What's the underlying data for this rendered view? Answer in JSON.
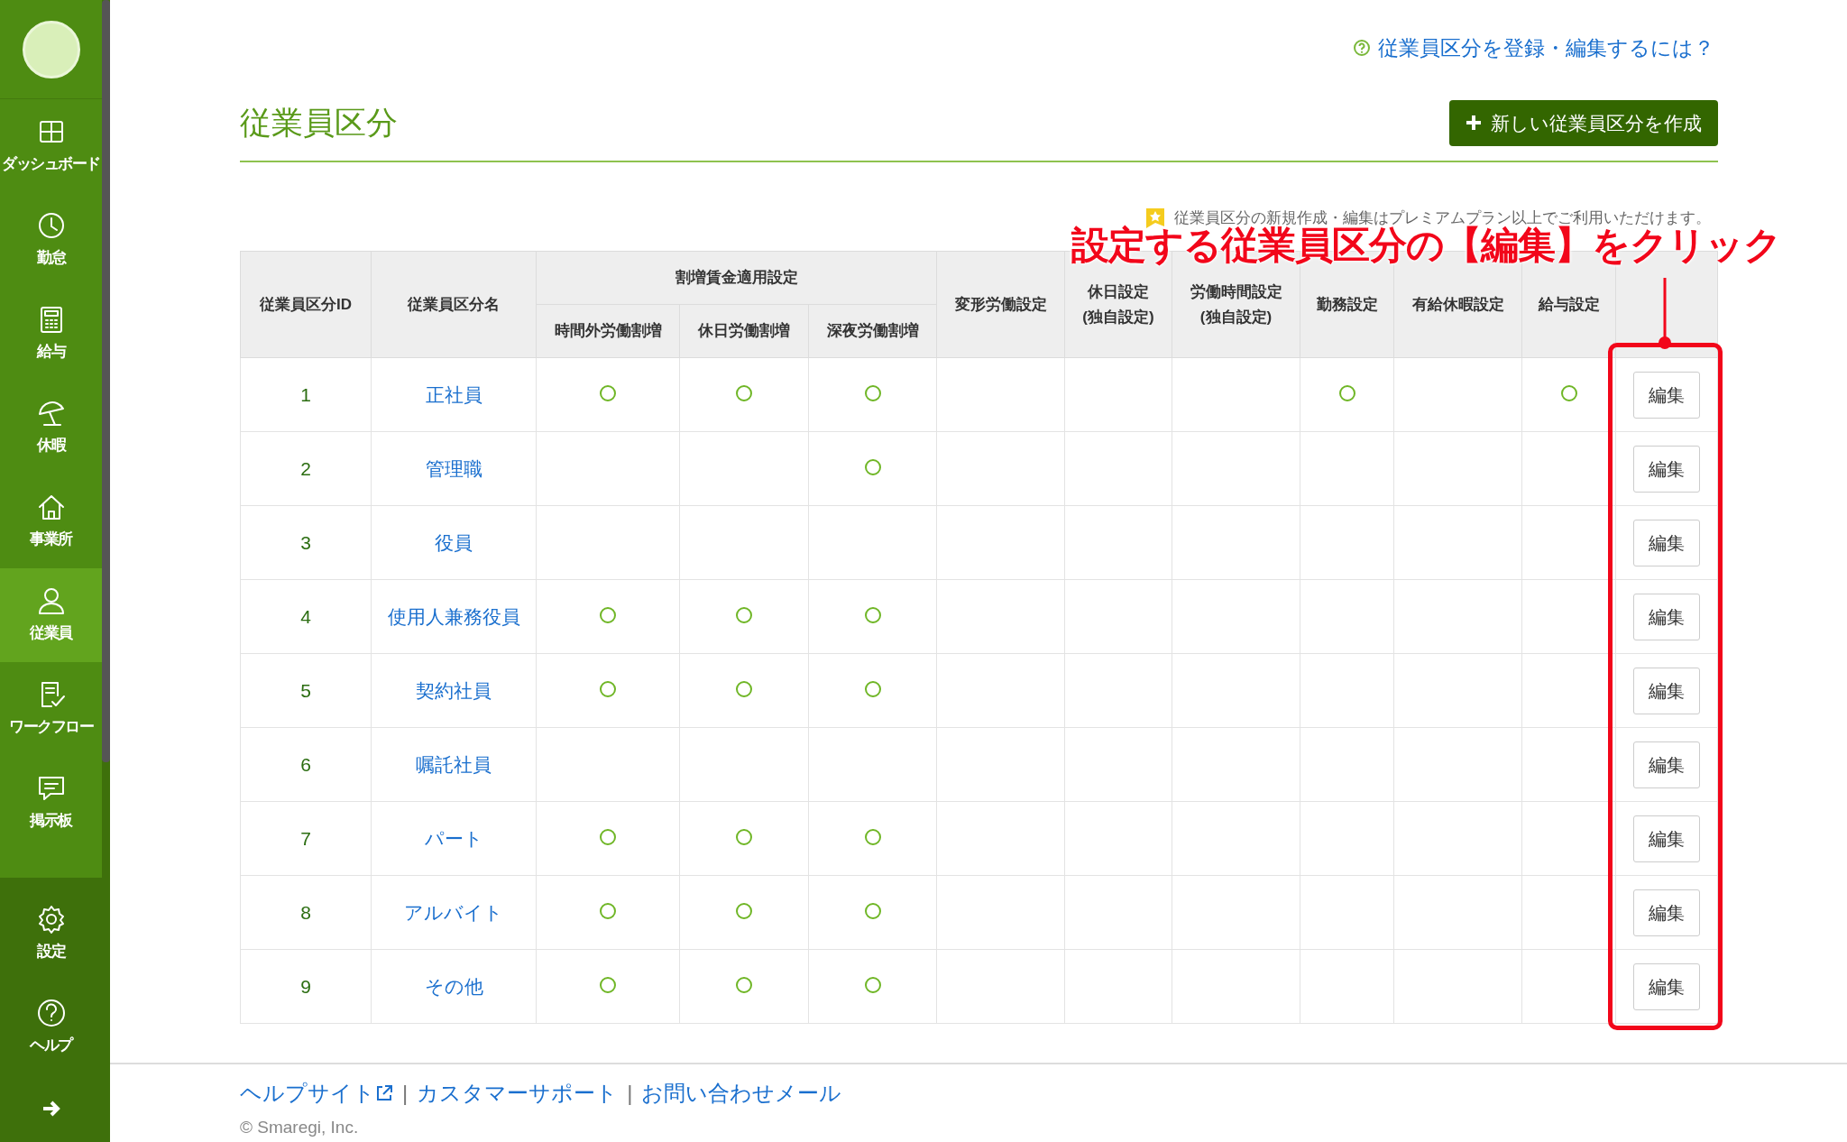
{
  "sidebar": {
    "items": [
      {
        "kind": "grid",
        "label": "ダッシュボード",
        "selected": false
      },
      {
        "kind": "clock",
        "label": "勤怠",
        "selected": false
      },
      {
        "kind": "calculator",
        "label": "給与",
        "selected": false
      },
      {
        "kind": "umbrella",
        "label": "休暇",
        "selected": false
      },
      {
        "kind": "house",
        "label": "事業所",
        "selected": false
      },
      {
        "kind": "person",
        "label": "従業員",
        "selected": true
      },
      {
        "kind": "checklist",
        "label": "ワークフロー",
        "selected": false
      },
      {
        "kind": "chat",
        "label": "掲示板",
        "selected": false
      }
    ],
    "bottom_items": [
      {
        "kind": "gear",
        "label": "設定"
      },
      {
        "kind": "help",
        "label": "ヘルプ"
      }
    ]
  },
  "help_link": "従業員区分を登録・編集するには？",
  "title": "従業員区分",
  "create_button": "新しい従業員区分を作成",
  "notice": "従業員区分の新規作成・編集はプレミアムプラン以上でご利用いただけます。",
  "table": {
    "columns": [
      {
        "label": "従業員区分ID"
      },
      {
        "label": "従業員区分名"
      },
      {
        "label": "割増賃金適用設定",
        "children": [
          "時間外労働割増",
          "休日労働割増",
          "深夜労働割増"
        ]
      },
      {
        "label": "変形労働設定"
      },
      {
        "label": "休日設定\n(独自設定)"
      },
      {
        "label": "労働時間設定\n(独自設定)"
      },
      {
        "label": "勤務設定"
      },
      {
        "label": "有給休暇設定"
      },
      {
        "label": "給与設定"
      }
    ],
    "rows": [
      {
        "id": "1",
        "name": "正社員",
        "flags": [
          true,
          true,
          true,
          false,
          false,
          false,
          true,
          false,
          true
        ],
        "edit": "編集"
      },
      {
        "id": "2",
        "name": "管理職",
        "flags": [
          false,
          false,
          true,
          false,
          false,
          false,
          false,
          false,
          false
        ],
        "edit": "編集"
      },
      {
        "id": "3",
        "name": "役員",
        "flags": [
          false,
          false,
          false,
          false,
          false,
          false,
          false,
          false,
          false
        ],
        "edit": "編集"
      },
      {
        "id": "4",
        "name": "使用人兼務役員",
        "flags": [
          true,
          true,
          true,
          false,
          false,
          false,
          false,
          false,
          false
        ],
        "edit": "編集"
      },
      {
        "id": "5",
        "name": "契約社員",
        "flags": [
          true,
          true,
          true,
          false,
          false,
          false,
          false,
          false,
          false
        ],
        "edit": "編集"
      },
      {
        "id": "6",
        "name": "嘱託社員",
        "flags": [
          false,
          false,
          false,
          false,
          false,
          false,
          false,
          false,
          false
        ],
        "edit": "編集"
      },
      {
        "id": "7",
        "name": "パート",
        "flags": [
          true,
          true,
          true,
          false,
          false,
          false,
          false,
          false,
          false
        ],
        "edit": "編集"
      },
      {
        "id": "8",
        "name": "アルバイト",
        "flags": [
          true,
          true,
          true,
          false,
          false,
          false,
          false,
          false,
          false
        ],
        "edit": "編集"
      },
      {
        "id": "9",
        "name": "その他",
        "flags": [
          true,
          true,
          true,
          false,
          false,
          false,
          false,
          false,
          false
        ],
        "edit": "編集"
      }
    ]
  },
  "annotation": "設定する従業員区分の【編集】をクリック",
  "footer": {
    "links": [
      "ヘルプサイト",
      "カスタマーサポート",
      "お問い合わせメール"
    ],
    "separator": "|",
    "copyright": "© Smaregi, Inc."
  }
}
